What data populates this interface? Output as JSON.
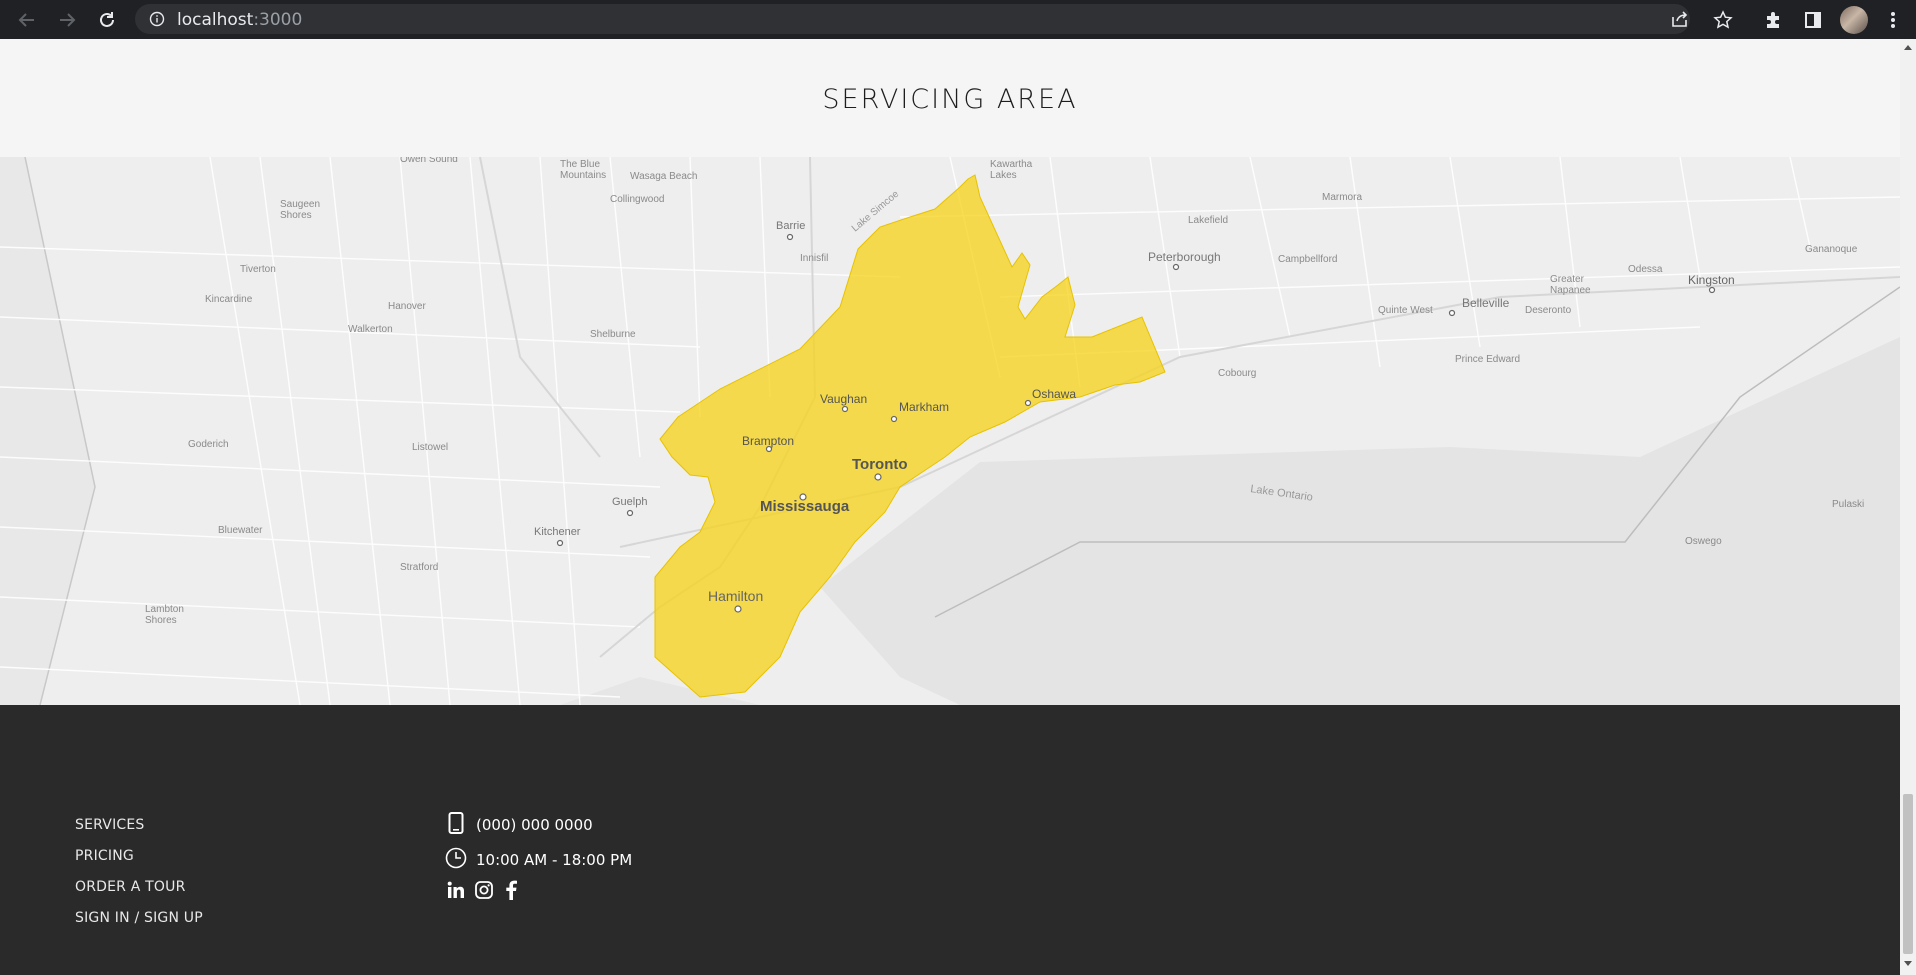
{
  "browser": {
    "url_host": "localhost",
    "url_port": ":3000",
    "icons": [
      "back-arrow-icon",
      "forward-arrow-icon",
      "reload-icon",
      "site-info-icon",
      "share-icon",
      "star-icon",
      "extensions-icon",
      "side-panel-icon",
      "profile-avatar",
      "kebab-menu-icon"
    ]
  },
  "section": {
    "title": "SERVICING AREA"
  },
  "map": {
    "highlight_color": "#f5d31e",
    "places": {
      "toronto": "Toronto",
      "mississauga": "Mississauga",
      "brampton": "Brampton",
      "vaughan": "Vaughan",
      "markham": "Markham",
      "oshawa": "Oshawa",
      "hamilton": "Hamilton",
      "guelph": "Guelph",
      "kitchener": "Kitchener",
      "barrie": "Barrie",
      "peterborough": "Peterborough",
      "kingston": "Kingston",
      "belleville": "Belleville",
      "lake_ontario": "Lake Ontario",
      "lake_simcoe": "Lake Simcoe",
      "wasaga_beach": "Wasaga Beach",
      "collingwood": "Collingwood",
      "owen_sound": "Owen Sound",
      "saugeen_shores": "Saugeen\nShores",
      "tiverton": "Tiverton",
      "kincardine": "Kincardine",
      "hanover": "Hanover",
      "walkerton": "Walkerton",
      "shelburne": "Shelburne",
      "goderich": "Goderich",
      "listowel": "Listowel",
      "bluewater": "Bluewater",
      "stratford": "Stratford",
      "lambton_shores": "Lambton\nShores",
      "innisfil": "Innisfil",
      "cobourg": "Cobourg",
      "campbellford": "Campbellford",
      "lakefield": "Lakefield",
      "marmora": "Marmora",
      "quinte_west": "Quinte West",
      "deseronto": "Deseronto",
      "greater_napanee": "Greater\nNapanee",
      "odessa": "Odessa",
      "prince_edward": "Prince Edward",
      "gananoque": "Gananoque",
      "oswego": "Oswego",
      "pulaski": "Pulaski",
      "kawartha_lakes": "Kawartha\nLakes",
      "the_blue_mountains": "The Blue\nMountains"
    }
  },
  "footer": {
    "links": [
      "SERVICES",
      "PRICING",
      "ORDER A TOUR",
      "SIGN IN / SIGN UP"
    ],
    "phone": "(000) 000 0000",
    "hours": "10:00 AM - 18:00 PM",
    "social": [
      "linkedin-icon",
      "instagram-icon",
      "facebook-icon"
    ]
  }
}
